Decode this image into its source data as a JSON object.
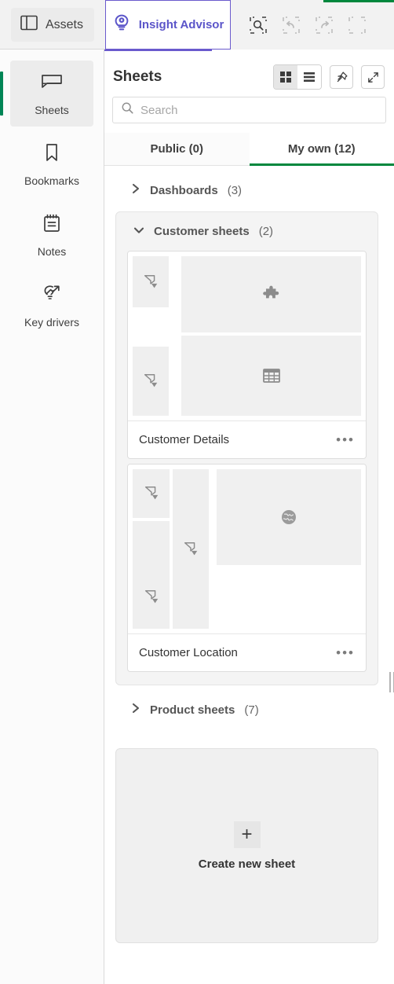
{
  "topbar": {
    "assets": {
      "label": "Assets",
      "icon": "panel-layout-icon"
    },
    "insight_advisor": {
      "label": "Insight Advisor",
      "icon": "insight-bulb-eye-icon"
    },
    "tools": [
      {
        "name": "selections-search-icon",
        "label": "Selection search",
        "disabled": false
      },
      {
        "name": "undo-icon",
        "label": "Undo",
        "disabled": true
      },
      {
        "name": "redo-icon",
        "label": "Redo",
        "disabled": true
      },
      {
        "name": "clear-selections-icon",
        "label": "Clear all selections",
        "disabled": true
      }
    ],
    "accent_green": "#00873d",
    "accent_purple": "#6a5acd"
  },
  "sidebar": {
    "items": [
      {
        "label": "Sheets",
        "icon": "sheet-icon",
        "active": true
      },
      {
        "label": "Bookmarks",
        "icon": "bookmark-icon",
        "active": false
      },
      {
        "label": "Notes",
        "icon": "notes-icon",
        "active": false
      },
      {
        "label": "Key drivers",
        "icon": "key-drivers-icon",
        "active": false
      }
    ]
  },
  "panel": {
    "title": "Sheets",
    "view_toggle": [
      {
        "name": "grid-view-icon",
        "label": "Grid view",
        "active": true
      },
      {
        "name": "list-view-icon",
        "label": "List view",
        "active": false
      }
    ],
    "pin_button": {
      "name": "pin-icon",
      "label": "Pin panel"
    },
    "expand_button": {
      "name": "expand-icon",
      "label": "Expand panel"
    },
    "search": {
      "placeholder": "Search",
      "value": ""
    },
    "tabs": [
      {
        "label": "Public (0)",
        "active": false
      },
      {
        "label": "My own (12)",
        "active": true
      }
    ]
  },
  "groups": [
    {
      "label": "Dashboards",
      "count": "(3)",
      "expanded": false,
      "chevron": "chevron-right-icon",
      "sheets": []
    },
    {
      "label": "Customer sheets",
      "count": "(2)",
      "expanded": true,
      "chevron": "chevron-down-icon",
      "sheets": [
        {
          "title": "Customer Details",
          "menu": "•••",
          "layout": "details",
          "objects": [
            "filterpane",
            "filterpane",
            "extension",
            "table"
          ]
        },
        {
          "title": "Customer Location",
          "menu": "•••",
          "layout": "location",
          "objects": [
            "filterpane",
            "filterpane",
            "filterpane",
            "map"
          ]
        }
      ]
    },
    {
      "label": "Product sheets",
      "count": "(7)",
      "expanded": false,
      "chevron": "chevron-right-icon",
      "sheets": []
    }
  ],
  "create_sheet": {
    "label": "Create new sheet",
    "icon": "plus-icon"
  },
  "resize_handle": {
    "name": "panel-resize-handle"
  }
}
